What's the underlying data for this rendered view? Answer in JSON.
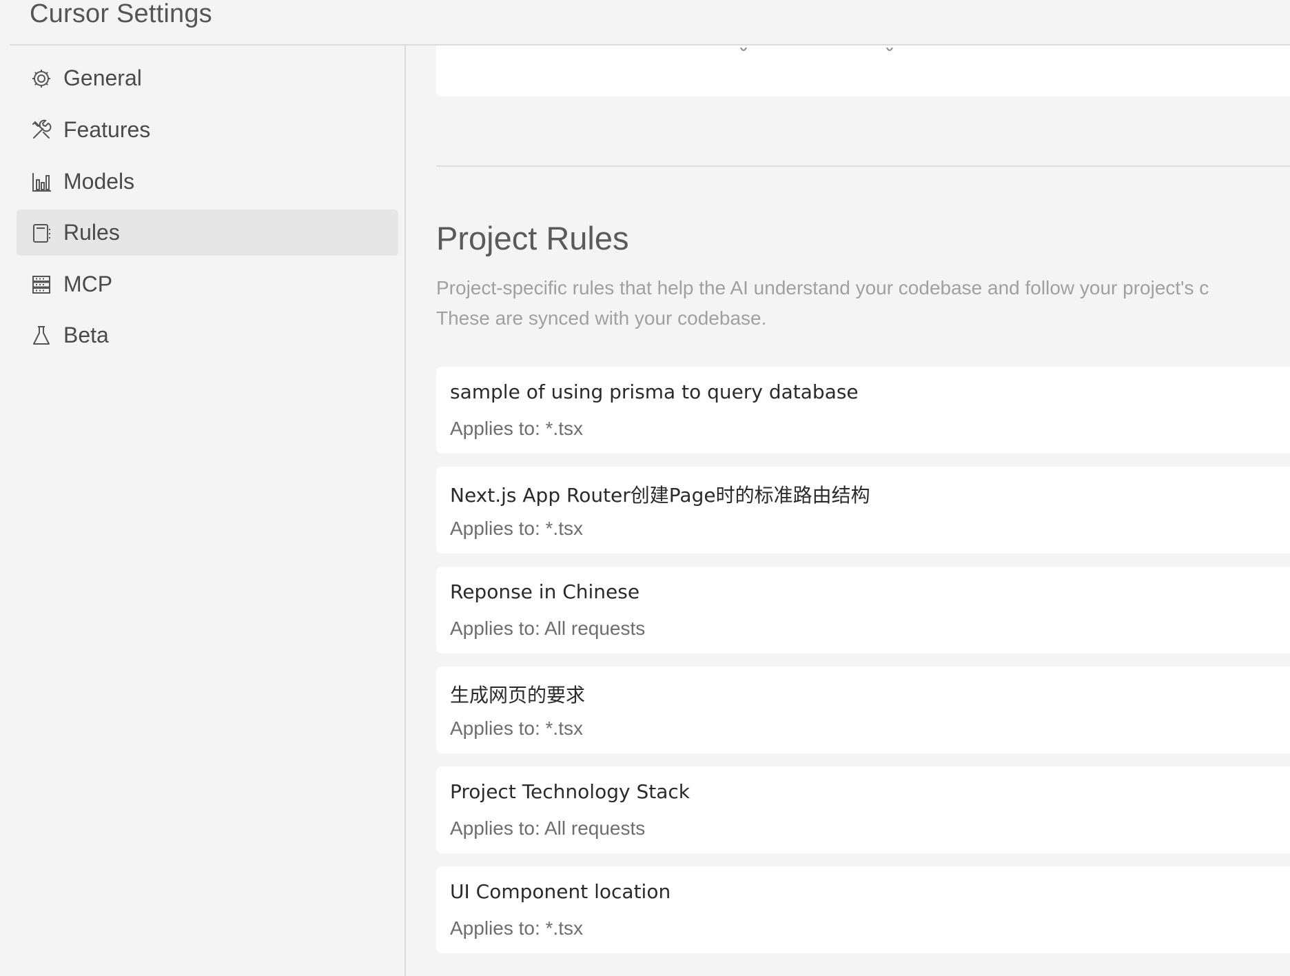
{
  "header": {
    "title": "Cursor Settings"
  },
  "sidebar": {
    "items": [
      {
        "label": "General",
        "icon": "gear-icon",
        "active": false
      },
      {
        "label": "Features",
        "icon": "tools-icon",
        "active": false
      },
      {
        "label": "Models",
        "icon": "bar-chart-icon",
        "active": false
      },
      {
        "label": "Rules",
        "icon": "rules-book-icon",
        "active": true
      },
      {
        "label": "MCP",
        "icon": "server-stack-icon",
        "active": false
      },
      {
        "label": "Beta",
        "icon": "flask-icon",
        "active": false
      }
    ]
  },
  "main": {
    "project_rules": {
      "title": "Project Rules",
      "description_line1": "Project-specific rules that help the AI understand your codebase and follow your project's c",
      "description_line2": "These are synced with your codebase.",
      "rules": [
        {
          "name": "sample of using prisma to query database",
          "applies_to": "Applies to: *.tsx"
        },
        {
          "name": "Next.js App Router创建Page时的标准路由结构",
          "applies_to": "Applies to: *.tsx"
        },
        {
          "name": "Reponse in Chinese",
          "applies_to": "Applies to: All requests"
        },
        {
          "name": "生成网页的要求",
          "applies_to": "Applies to: *.tsx"
        },
        {
          "name": "Project Technology Stack",
          "applies_to": "Applies to: All requests"
        },
        {
          "name": "UI Component location",
          "applies_to": "Applies to: *.tsx"
        }
      ]
    }
  },
  "colors": {
    "background": "#f4f4f4",
    "card": "#ffffff",
    "active_item": "#e6e6e6",
    "divider": "#dcdcdc",
    "muted_text": "#a0a0a0"
  }
}
